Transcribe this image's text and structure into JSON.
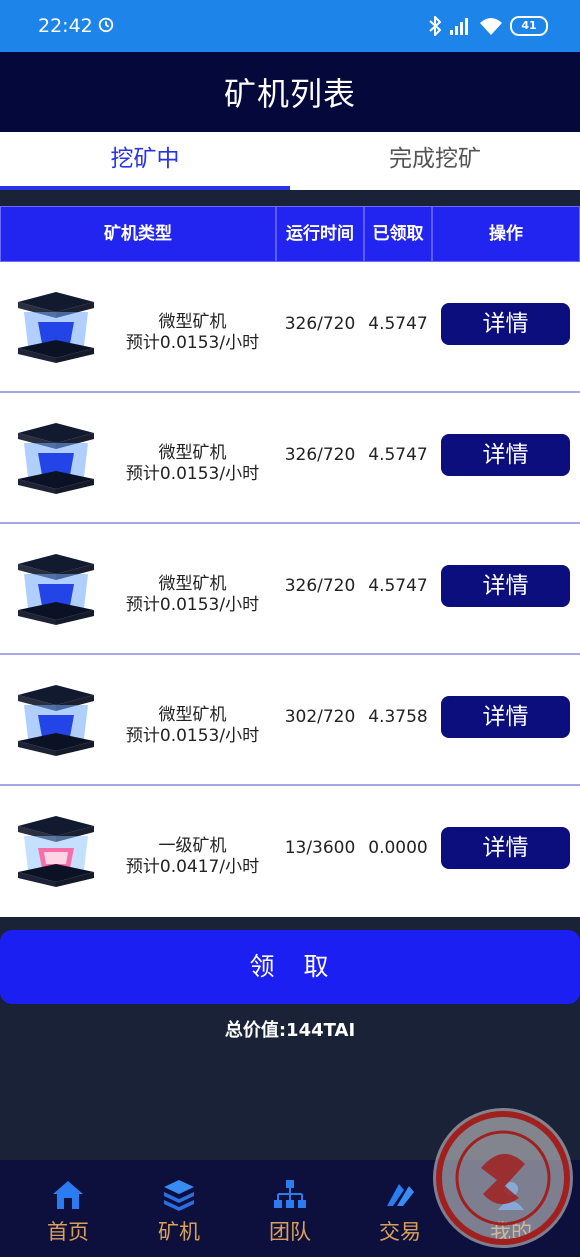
{
  "status": {
    "time": "22:42",
    "battery": "41"
  },
  "title": "矿机列表",
  "tabs": [
    {
      "label": "挖矿中"
    },
    {
      "label": "完成挖矿"
    }
  ],
  "table": {
    "headers": [
      "矿机类型",
      "运行时间",
      "已领取",
      "操作"
    ],
    "rows": [
      {
        "name": "微型矿机",
        "rate": "预计0.0153/小时",
        "runtime": "326/720",
        "claimed": "4.5747",
        "action": "详情"
      },
      {
        "name": "微型矿机",
        "rate": "预计0.0153/小时",
        "runtime": "326/720",
        "claimed": "4.5747",
        "action": "详情"
      },
      {
        "name": "微型矿机",
        "rate": "预计0.0153/小时",
        "runtime": "326/720",
        "claimed": "4.5747",
        "action": "详情"
      },
      {
        "name": "微型矿机",
        "rate": "预计0.0153/小时",
        "runtime": "302/720",
        "claimed": "4.3758",
        "action": "详情"
      },
      {
        "name": "一级矿机",
        "rate": "预计0.0417/小时",
        "runtime": "13/3600",
        "claimed": "0.0000",
        "action": "详情"
      }
    ]
  },
  "claim_button": "领　取",
  "total_value": "总价值:144TAI",
  "nav": [
    {
      "label": "首页",
      "icon": "home-icon"
    },
    {
      "label": "矿机",
      "icon": "miner-icon"
    },
    {
      "label": "团队",
      "icon": "team-icon"
    },
    {
      "label": "交易",
      "icon": "trade-icon"
    },
    {
      "label": "我的",
      "icon": "profile-icon"
    }
  ],
  "colors": {
    "primary": "#2224f0",
    "navy": "#05083a",
    "nav_label": "#d9a05a",
    "detail_button": "#0c0e7e",
    "status_bar": "#1d84ea"
  }
}
